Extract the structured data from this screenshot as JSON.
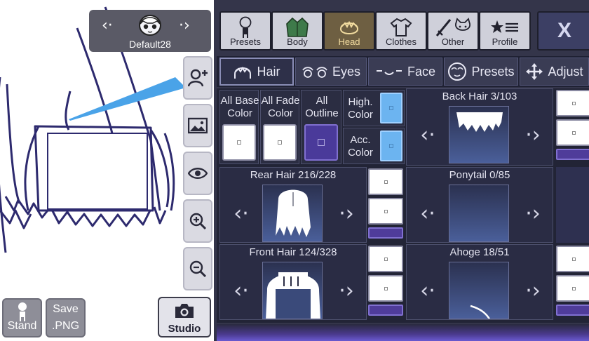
{
  "character": {
    "name": "Default28"
  },
  "canvas_tools": [
    {
      "name": "add-character-icon"
    },
    {
      "name": "background-image-icon"
    },
    {
      "name": "eye-icon"
    },
    {
      "name": "zoom-in-icon"
    },
    {
      "name": "zoom-out-icon"
    }
  ],
  "bottom_buttons": {
    "stand": "Stand",
    "save_line1": "Save",
    "save_line2": ".PNG",
    "studio": "Studio"
  },
  "categories": [
    {
      "label": "Presets",
      "icon": "chibi-figure-icon",
      "active": false
    },
    {
      "label": "Body",
      "icon": "jacket-icon",
      "active": false
    },
    {
      "label": "Head",
      "icon": "hair-head-icon",
      "active": true
    },
    {
      "label": "Clothes",
      "icon": "shirt-icon",
      "active": false
    },
    {
      "label": "Other",
      "icon": "sword-cat-icon",
      "active": false
    },
    {
      "label": "Profile",
      "icon": "star-list-icon",
      "active": false
    }
  ],
  "close_label": "X",
  "tabs": [
    {
      "label": "Hair",
      "icon": "hair-icon",
      "active": true
    },
    {
      "label": "Eyes",
      "icon": "eyes-icon",
      "active": false
    },
    {
      "label": "Face",
      "icon": "face-icon",
      "active": false
    },
    {
      "label": "Presets",
      "icon": "preset-face-icon",
      "active": false
    },
    {
      "label": "Adjust",
      "icon": "move-arrows-icon",
      "active": false
    }
  ],
  "color_options": {
    "all_base": {
      "line1": "All Base",
      "line2": "Color",
      "color": "#ffffff"
    },
    "all_fade": {
      "line1": "All Fade",
      "line2": "Color",
      "color": "#ffffff"
    },
    "all_outline": {
      "line1": "All",
      "line2": "Outline",
      "color": "#4a3a9a"
    },
    "high": {
      "line1": "High.",
      "line2": "Color",
      "color": "#6cb4f0"
    },
    "acc": {
      "line1": "Acc.",
      "line2": "Color",
      "color": "#6cb4f0"
    }
  },
  "parts": [
    {
      "title": "Back Hair 3/103"
    },
    {
      "title": "Rear Hair 216/228"
    },
    {
      "title": "Ponytail 0/85"
    },
    {
      "title": "Front Hair 124/328"
    },
    {
      "title": "Ahoge 18/51"
    }
  ],
  "colors": {
    "panel": "#34354a",
    "accent": "#4f3c9a",
    "active_tab": "#6e5f42"
  }
}
